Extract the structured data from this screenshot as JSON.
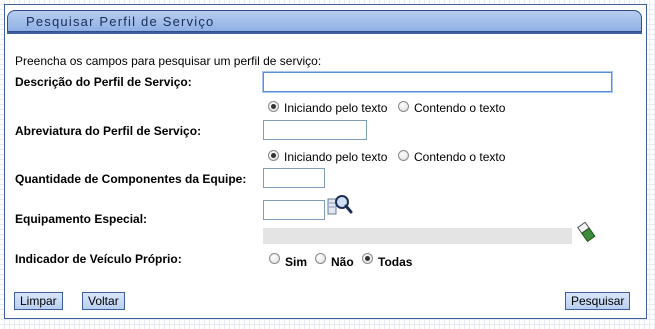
{
  "panel": {
    "title": "Pesquisar Perfil de Serviço"
  },
  "intro": "Preencha os campos para pesquisar um perfil de serviço:",
  "descricao": {
    "label": "Descrição do Perfil de Serviço:",
    "value": "",
    "options": [
      "Iniciando pelo texto",
      "Contendo o texto"
    ],
    "selected": "Iniciando pelo texto"
  },
  "abreviatura": {
    "label": "Abreviatura do Perfil de Serviço:",
    "value": "",
    "options": [
      "Iniciando pelo texto",
      "Contendo o texto"
    ],
    "selected": "Iniciando pelo texto"
  },
  "quantidade": {
    "label": "Quantidade de Componentes da Equipe:",
    "value": ""
  },
  "equipamento": {
    "label": "Equipamento Especial:",
    "value": "",
    "description": "",
    "icons": [
      "search-icon",
      "eraser-icon"
    ]
  },
  "veiculo": {
    "label": "Indicador de Veículo Próprio:",
    "options": [
      "Sim",
      "Não",
      "Todas"
    ],
    "selected": "Todas"
  },
  "buttons": {
    "limpar": "Limpar",
    "voltar": "Voltar",
    "pesquisar": "Pesquisar"
  },
  "colors": {
    "accent": "#3f5f9c",
    "titlebar": "#a9c2ec"
  }
}
